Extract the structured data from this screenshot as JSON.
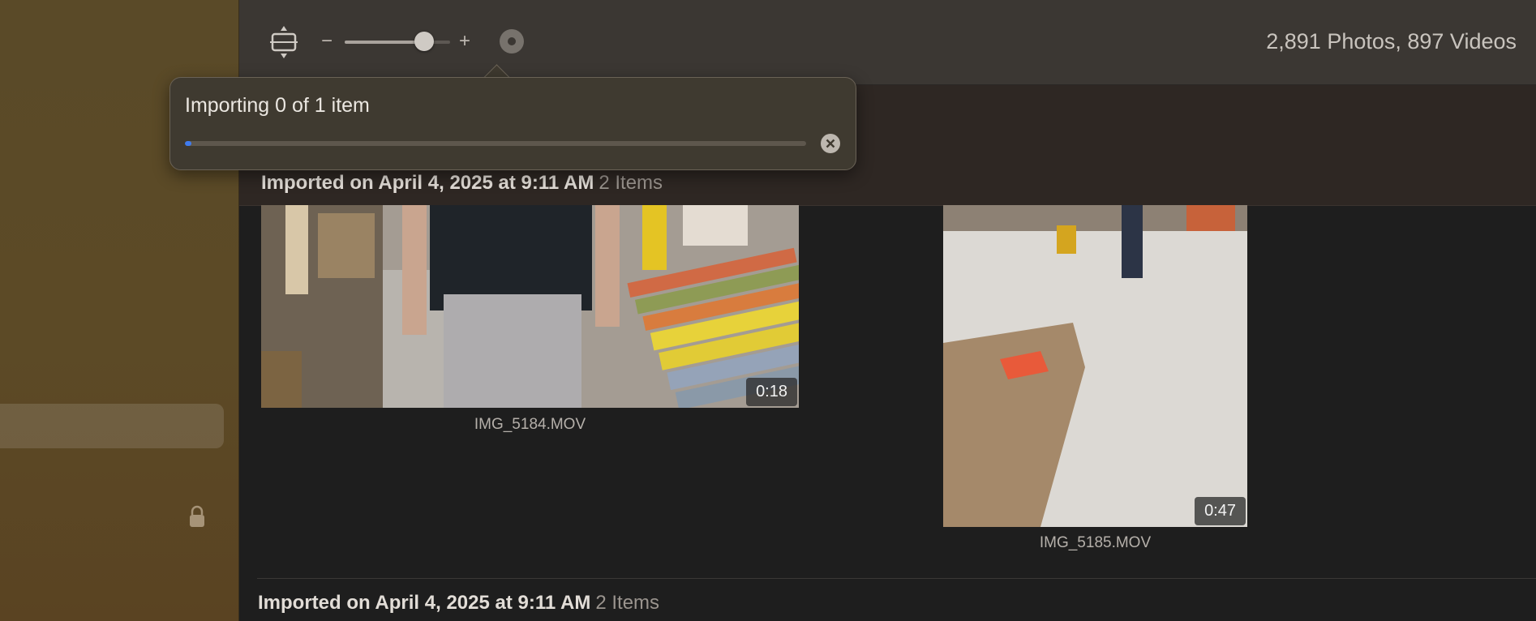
{
  "toolbar": {
    "zoom_minus": "−",
    "zoom_plus": "+",
    "zoom_level": 0.75,
    "library_counts": "2,891 Photos, 897 Videos"
  },
  "import_popover": {
    "title": "Importing 0 of 1 item",
    "progress": 0.01
  },
  "sections": [
    {
      "title": "Imported on April 4, 2025 at 9:11 AM",
      "count": "2 Items"
    },
    {
      "title": "Imported on April 4, 2025 at 9:11 AM",
      "count": "2 Items"
    }
  ],
  "items": [
    {
      "filename": "IMG_5184.MOV",
      "duration": "0:18"
    },
    {
      "filename": "IMG_5185.MOV",
      "duration": "0:47"
    }
  ],
  "colors": {
    "accent": "#3f7bef",
    "sidebar": "#5a4a28",
    "toolbar": "#3b3733"
  },
  "icons": [
    "layout-toggle-icon",
    "import-status-icon",
    "cancel-icon",
    "lock-icon"
  ]
}
